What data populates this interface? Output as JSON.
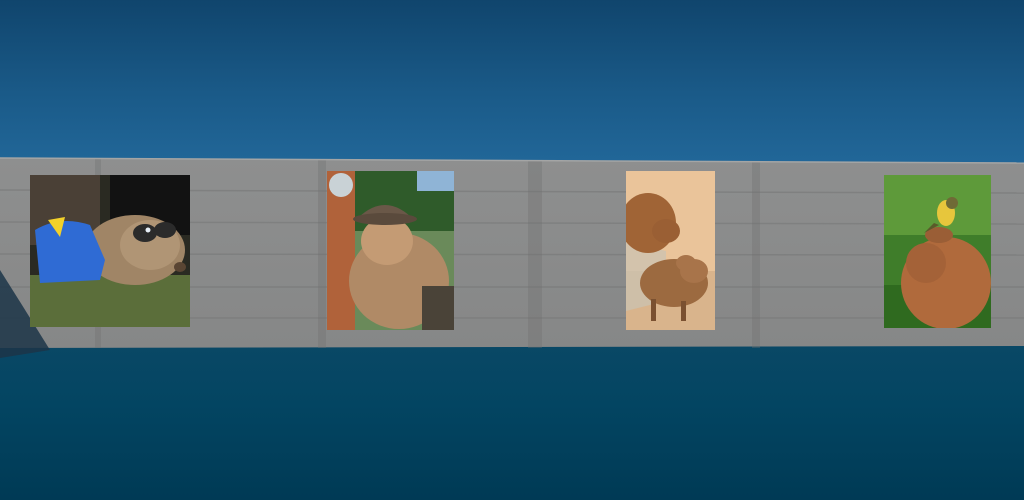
{
  "scene": {
    "description_colors": {
      "sky_top": "#10456d",
      "sky_bottom": "#22689a",
      "floor": "#003a55",
      "wall": "#8c8c8c",
      "wall_shadow": "#787878"
    }
  },
  "gallery": {
    "frames": [
      {
        "id": "capybara-batman",
        "icon": "capybara-photo"
      },
      {
        "id": "capybara-hat",
        "icon": "capybara-photo"
      },
      {
        "id": "capybara-family",
        "icon": "capybara-photo"
      },
      {
        "id": "capybara-bird",
        "icon": "capybara-photo"
      }
    ]
  }
}
